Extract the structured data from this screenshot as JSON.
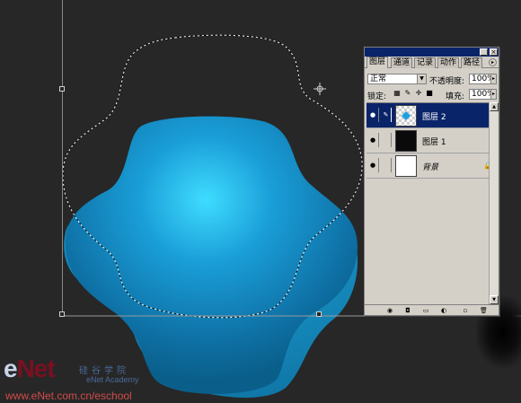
{
  "canvas": {
    "background_color": "#272727",
    "shape_color": "#1fa8e0",
    "shape_highlight": "#40d8ff",
    "shape_dark": "#0a5f8a"
  },
  "layers_panel": {
    "tabs": [
      {
        "label": "图层",
        "active": true
      },
      {
        "label": "通道",
        "active": false
      },
      {
        "label": "记录",
        "active": false
      },
      {
        "label": "动作",
        "active": false
      },
      {
        "label": "路径",
        "active": false
      }
    ],
    "blend_mode": "正常",
    "opacity_label": "不透明度:",
    "opacity_value": "100%",
    "lock_label": "锁定:",
    "fill_label": "填充:",
    "fill_value": "100%",
    "layers": [
      {
        "name": "图层 2",
        "selected": true,
        "visible": true,
        "thumb": "transparent-blue-diamond",
        "locked": false
      },
      {
        "name": "图层 1",
        "selected": false,
        "visible": true,
        "thumb": "black",
        "locked": false
      },
      {
        "name": "背景",
        "selected": false,
        "visible": true,
        "thumb": "white",
        "locked": true
      }
    ],
    "title_btn_min": "_",
    "title_btn_close": "×",
    "menu_arrow": "▸",
    "eye_glyph": "●",
    "brush_glyph": "✎",
    "lock_glyph": "🔒",
    "scroll_up": "▲",
    "scroll_down": "▼",
    "dropdown_arrow": "▼",
    "lock_icons": [
      "▦",
      "✎",
      "✛",
      "■"
    ],
    "footer_icons": [
      "◉",
      "◘",
      "▭",
      "◐",
      "▫",
      "🗑"
    ]
  },
  "watermark": {
    "logo_e": "e",
    "logo_rest": "Net",
    "sub": "硅谷学院",
    "url": "www.eNet.com.cn/eschool",
    "en": "eNet Academy"
  }
}
